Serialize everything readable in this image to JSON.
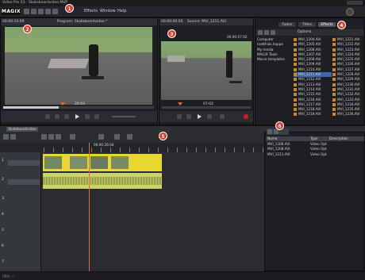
{
  "window": {
    "title": "Video Pro X3 - Skateboardvideo.MVP"
  },
  "menubar": {
    "logo": "MAGIX",
    "items": [
      "Effects",
      "Window",
      "Help"
    ]
  },
  "program_monitor": {
    "time": "00:00:10:09",
    "title": "Program: Skateboardvideo *",
    "timecode": "26:04"
  },
  "source_monitor": {
    "time": "00:00:00:00",
    "title": "Source: MVI_1211.AVI",
    "duration": "00:00:07:02",
    "timecode": "07:02"
  },
  "browser": {
    "tabs": [
      "Fades",
      "Titles",
      "Effects"
    ],
    "options_label": "Options",
    "folders": [
      "Computer",
      "matthias.hoppe",
      "My media",
      "MAGIX Tools",
      "Movie templates"
    ],
    "files_col1": [
      "MVI_1204.AVI",
      "MVI_1205.AVI",
      "MVI_1206.AVI",
      "MVI_1207.AVI",
      "MVI_1208.AVI",
      "MVI_1209.AVI",
      "MVI_1210.AVI",
      "MVI_1211.AVI",
      "MVI_1212.AVI",
      "MVI_1213.AVI",
      "MVI_1214.AVI",
      "MVI_1215.AVI",
      "MVI_1216.AVI",
      "MVI_1217.AVI",
      "MVI_1218.AVI",
      "MVI_1219.AVI"
    ],
    "files_col2": [
      "MVI_1221.AVI",
      "MVI_1222.AVI",
      "MVI_1223.AVI",
      "MVI_1224.AVI",
      "MVI_1225.AVI",
      "MVI_1226.AVI",
      "MVI_1227.AVI",
      "MVI_1228.AVI",
      "MVI_1229.AVI",
      "MVI_1230.AVI",
      "MVI_1231.AVI",
      "MVI_1232.AVI",
      "MVI_1233.AVI",
      "MVI_1234.AVI",
      "MVI_1235.AVI",
      "MVI_1236.AVI"
    ],
    "selected_file": "MVI_1211.AVI"
  },
  "timeline": {
    "tab_label": "Skateboardvideo",
    "timecode": "00:00:26:04",
    "tracks": [
      "1",
      "2",
      "3",
      "4",
      "5",
      "6",
      "7"
    ]
  },
  "project_bin": {
    "headers": [
      "Name",
      "Type",
      "Description"
    ],
    "rows": [
      {
        "name": "MVI_1206.AVI",
        "type": "Video Opt"
      },
      {
        "name": "MVI_1208.AVI",
        "type": "Video Opt"
      },
      {
        "name": "MVI_1211.AVI",
        "type": "Video Opt"
      }
    ]
  },
  "markers": [
    "1",
    "2",
    "3",
    "4",
    "5",
    "6"
  ],
  "statusbar": {
    "text": "CPU: —"
  }
}
